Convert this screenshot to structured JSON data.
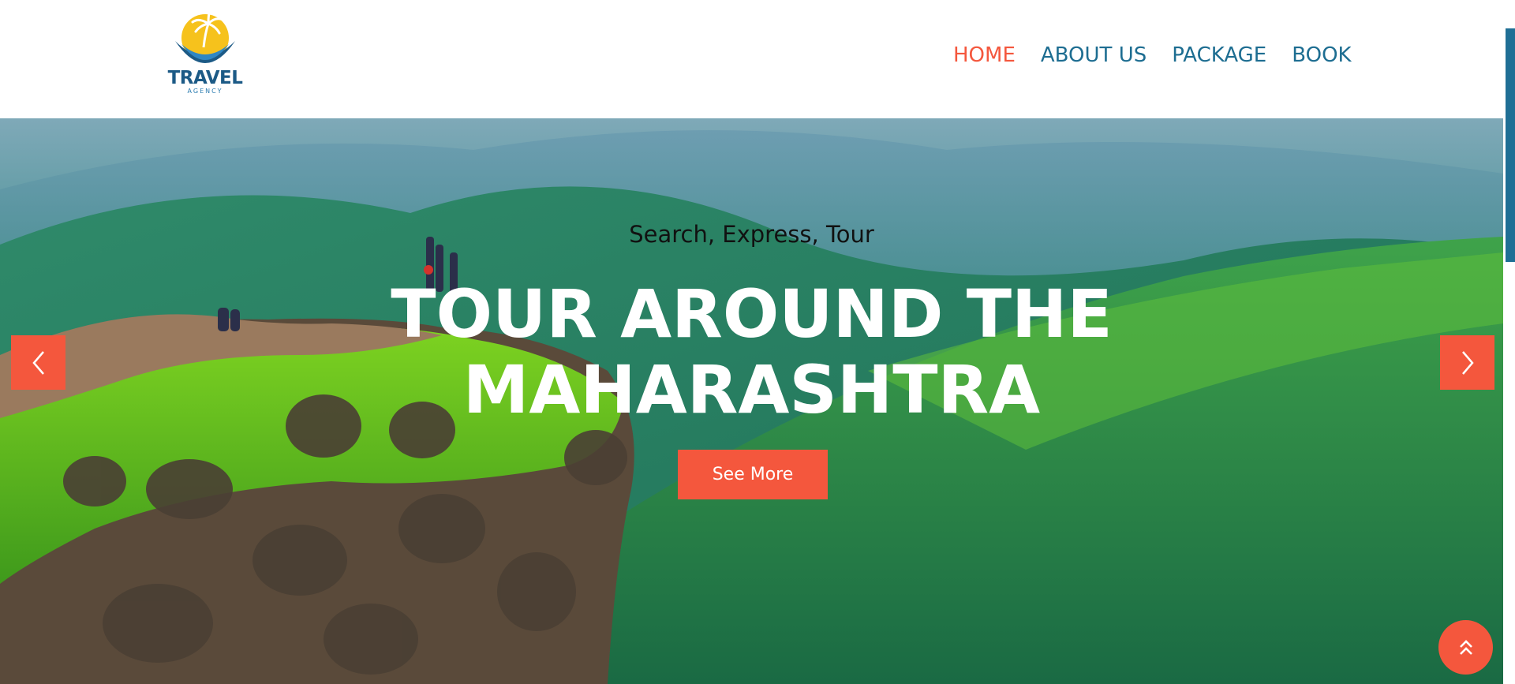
{
  "brand": {
    "name": "TRAVEL",
    "tagline": "AGENCY"
  },
  "nav": {
    "items": [
      {
        "label": "HOME",
        "active": true
      },
      {
        "label": "ABOUT US",
        "active": false
      },
      {
        "label": "PACKAGE",
        "active": false
      },
      {
        "label": "BOOK",
        "active": false
      }
    ]
  },
  "hero": {
    "subtitle": "Search, Express, Tour",
    "headline_line1": "TOUR AROUND THE",
    "headline_line2": "MAHARASHTRA",
    "cta_label": "See More"
  },
  "controls": {
    "prev_icon": "chevron-left-icon",
    "next_icon": "chevron-right-icon",
    "back_to_top_icon": "double-chevron-up-icon"
  },
  "colors": {
    "accent": "#f4573d",
    "nav_text": "#1d6d91",
    "brand_blue": "#1c5a86"
  }
}
